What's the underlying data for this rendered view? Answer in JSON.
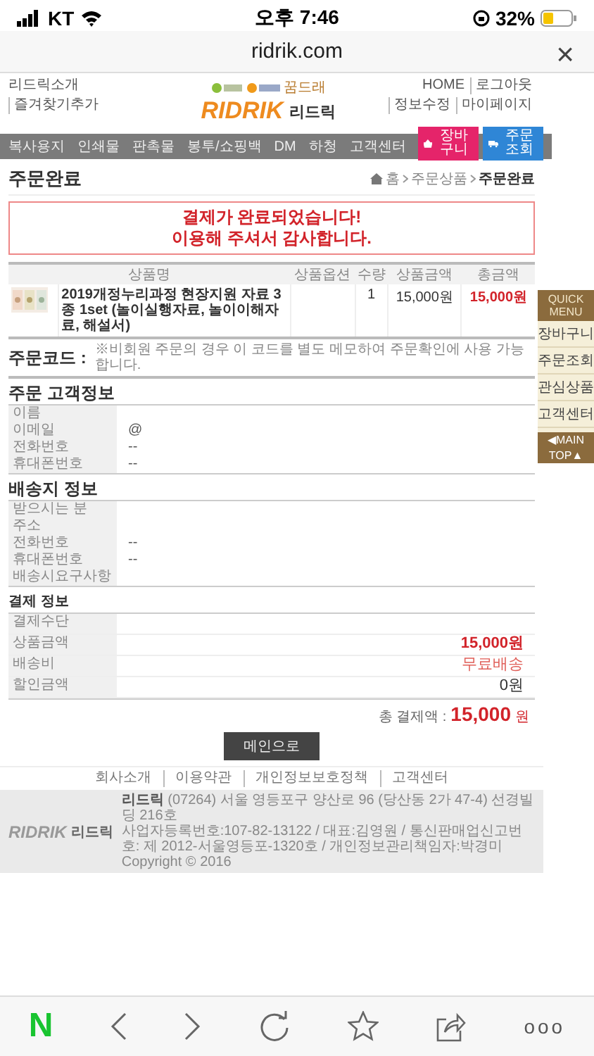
{
  "status_bar": {
    "carrier": "KT",
    "time": "오후 7:46",
    "battery": "32%"
  },
  "browser": {
    "url": "ridrik.com",
    "close": "×"
  },
  "header": {
    "left_links": [
      "리드릭소개",
      "즐겨찾기추가"
    ],
    "right_links": [
      "HOME",
      "로그아웃",
      "정보수정",
      "마이페이지"
    ],
    "partner_text": "꿈드래",
    "logo": "RIDRIK",
    "logo_name": "리드릭"
  },
  "nav": {
    "items": [
      "복사용지",
      "인쇄물",
      "판촉물",
      "봉투/쇼핑백",
      "DM",
      "하청",
      "고객센터"
    ],
    "buttons": [
      {
        "label": "장바구니",
        "kind": "cart"
      },
      {
        "label": "주문조회",
        "kind": "truck"
      }
    ]
  },
  "page_title": "주문완료",
  "breadcrumb": [
    "홈",
    "주문상품",
    "주문완료"
  ],
  "message": [
    "결제가 완료되었습니다!",
    "이용해 주셔서 감사합니다."
  ],
  "order_table": {
    "columns": [
      "상품명",
      "상품옵션",
      "수량",
      "상품금액",
      "총금액"
    ],
    "rows": [
      {
        "kind": "picture",
        "name": "2019개정누리과정 현장지원 자료 3종 1set (놀이실행자료, 놀이이해자료, 해설서)",
        "quantity": "1",
        "price": "15,000원",
        "total": "15,000원"
      }
    ]
  },
  "order_code": {
    "label": "주문코드 :",
    "note": "※비회원 주문의 경우 이 코드를 별도 메모하여 주문확인에 사용 가능합니다."
  },
  "sections": [
    {
      "title": "주문 고객정보",
      "kind": "major",
      "rows": [
        {
          "label": "이름",
          "kind": "plain"
        },
        {
          "label": "이메일",
          "value": "@",
          "kind": "plain"
        },
        {
          "label": "전화번호",
          "value": "--",
          "kind": "plain"
        },
        {
          "label": "휴대폰번호",
          "value": "--",
          "kind": "plain"
        }
      ]
    },
    {
      "title": "배송지 정보",
      "kind": "major",
      "rows": [
        {
          "label": "받으시는 분",
          "kind": "plain"
        },
        {
          "label": "주소",
          "kind": "plain"
        },
        {
          "label": "전화번호",
          "value": "--",
          "kind": "plain"
        },
        {
          "label": "휴대폰번호",
          "value": "--",
          "kind": "plain"
        },
        {
          "label": "배송시요구사항",
          "kind": "plain"
        }
      ]
    },
    {
      "title": "결제 정보",
      "kind": "minor",
      "rows": [
        {
          "label": "결제수단",
          "kind": "plain"
        },
        {
          "label": "상품금액",
          "value": "15,000원",
          "kind": "price"
        },
        {
          "label": "배송비",
          "value": "무료배송",
          "kind": "notice"
        },
        {
          "label": "할인금액",
          "value": "0원",
          "kind": "amount"
        }
      ]
    }
  ],
  "total": {
    "label": "총 결제액 :",
    "amount": "15,000",
    "unit": "원"
  },
  "confirm_button": "메인으로",
  "footer": {
    "links": [
      "회사소개",
      "이용약관",
      "개인정보보호정책",
      "고객센터"
    ],
    "logo": "RIDRIK",
    "logo_name": "리드릭",
    "company": "리드릭",
    "address": "(07264) 서울 영등포구 양산로 96 (당산동 2가 47-4) 선경빌딩 216호",
    "info": "사업자등록번호:107-82-13122 / 대표:김영원 / 통신판매업신고번호: 제 2012-서울영등포-1320호 / 개인정보관리책임자:박경미 Copyright © 2016"
  },
  "quick_menu": {
    "title": "QUICK MENU",
    "items": [
      "장바구니",
      "주문조회",
      "관심상품",
      "고객센터"
    ],
    "main": "◀MAIN",
    "top": "TOP▲"
  },
  "toolbar": {
    "naver": "N",
    "more": "ooo"
  }
}
